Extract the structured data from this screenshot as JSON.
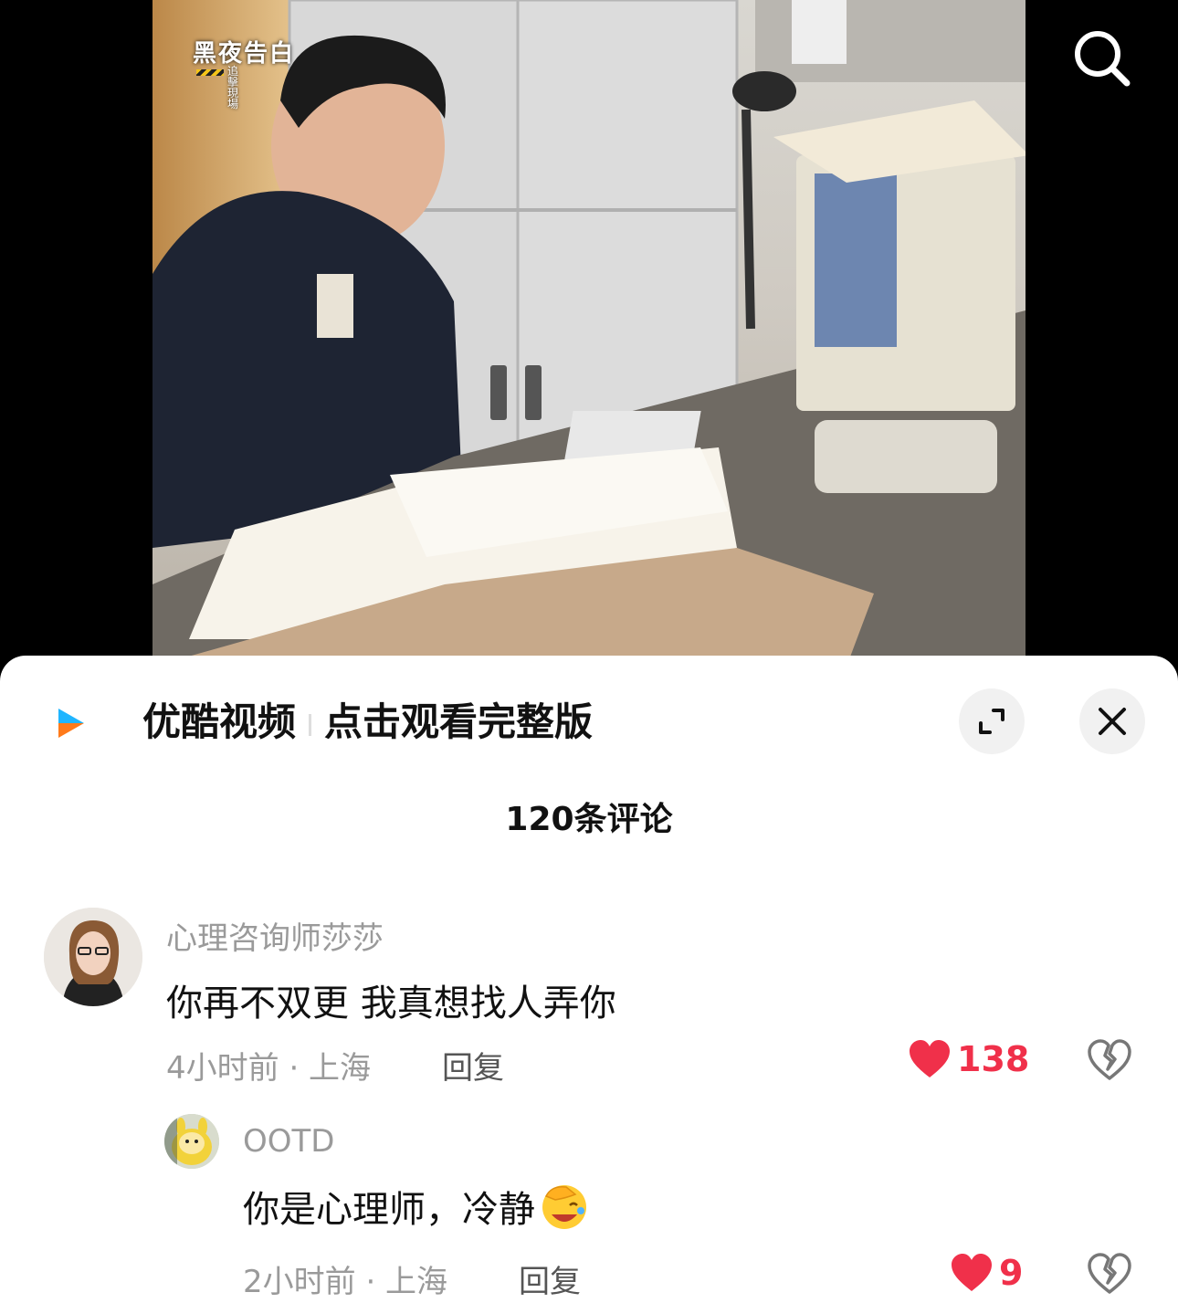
{
  "video": {
    "watermark_title": "黑夜告白",
    "watermark_sub": "追擊現場"
  },
  "toolbar": {
    "search_icon": "search-icon"
  },
  "ad": {
    "brand": "优酷视频",
    "cta": "点击观看完整版",
    "logo_colors": [
      "#1fb5ff",
      "#ff7a1a"
    ]
  },
  "comments": {
    "count_label": "120条评论",
    "items": [
      {
        "username": "心理咨询师莎莎",
        "text": "你再不双更 我真想找人弄你",
        "time_location": "4小时前 · 上海",
        "reply_label": "回复",
        "likes": "138",
        "liked": true
      },
      {
        "username": "OOTD",
        "text": "你是心理师，冷静",
        "emoji": "face-with-hand-over-eyes-laughing",
        "time_location": "2小时前 · 上海",
        "reply_label": "回复",
        "likes": "9",
        "liked": true
      }
    ]
  },
  "colors": {
    "like_red": "#f0304a",
    "meta_gray": "#9a9a9a"
  }
}
